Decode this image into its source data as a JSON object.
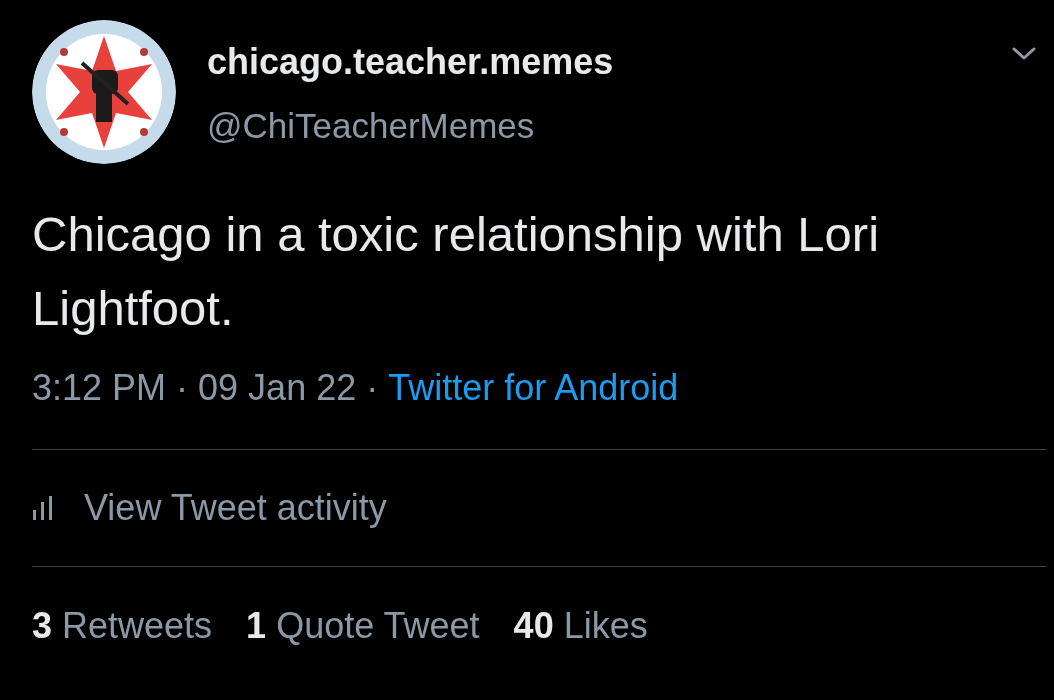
{
  "author": {
    "name": "chicago.teacher.memes",
    "handle": "@ChiTeacherMemes"
  },
  "tweet": {
    "text": "Chicago in a toxic relationship with Lori Lightfoot."
  },
  "meta": [
    {
      "kind": "plain",
      "text": "3:12 PM"
    },
    {
      "kind": "separator",
      "text": "·"
    },
    {
      "kind": "plain",
      "text": "09 Jan 22"
    },
    {
      "kind": "separator",
      "text": "·"
    },
    {
      "kind": "link",
      "text": "Twitter for Android"
    }
  ],
  "activity": {
    "label": "View Tweet activity"
  },
  "stats": [
    {
      "count": "3",
      "label": "Retweets"
    },
    {
      "count": "1",
      "label": "Quote Tweet"
    },
    {
      "count": "40",
      "label": "Likes"
    }
  ]
}
